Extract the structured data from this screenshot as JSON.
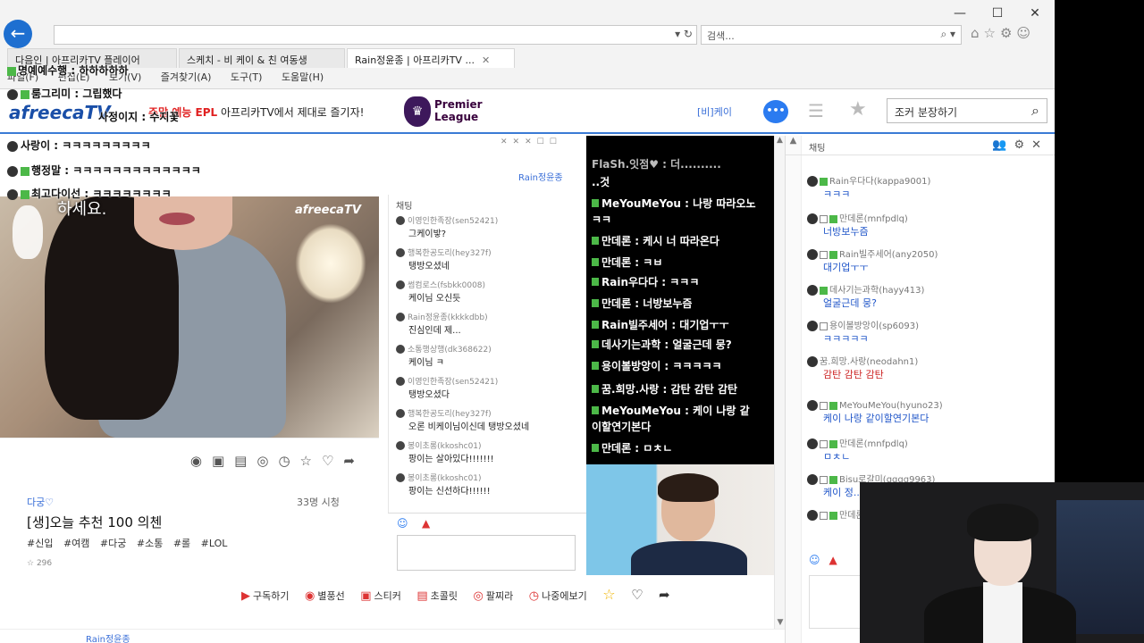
{
  "browser": {
    "search_placeholder": "검색...",
    "tabs": [
      {
        "label": "다음인 | 아프리카TV 플레이어"
      },
      {
        "label": "스케치 - 비 케이 & 친 여동생"
      },
      {
        "label": "Rain정윤종 | 아프리카TV ..."
      }
    ],
    "menu": [
      "파일(F)",
      "편집(E)",
      "보기(V)",
      "즐겨찾기(A)",
      "도구(T)",
      "도움말(H)"
    ]
  },
  "header": {
    "logo": "afreecaTV",
    "promo_red": "주말 예능 EPL",
    "promo_rest": "아프리카TV에서 제대로 즐기자!",
    "pl_line1": "Premier",
    "pl_line2": "League",
    "user": "[비]케이",
    "search_placeholder": "조커 분장하기"
  },
  "overlay_chat": [
    "명예예수행 : 하하하하하",
    "룸그리미 : 그립했다",
    "사정이지 : 수지꽃",
    "사랑이 : ㅋㅋㅋㅋㅋㅋㅋㅋㅋ",
    "행정말 : ㅋㅋㅋㅋㅋㅋㅋㅋㅋㅋㅋㅋㅋ",
    "최고다이선 : ㅋㅋㅋㅋㅋㅋㅋㅋ"
  ],
  "inner": {
    "user": "Rain정윤종",
    "video_logo": "afreecaTV",
    "video_caption": "하세요."
  },
  "stream": {
    "streamer": "다궁♡",
    "viewers": "33명 시청",
    "title": "[생]오늘 추천 100 의첸",
    "tags": "#신입 #여캠 #다궁 #소통 #롤 #LOL",
    "likes": "296"
  },
  "mid_chat": {
    "title": "채팅",
    "messages": [
      {
        "nick": "이영인한족장(sen52421)",
        "text": "그케이밯?"
      },
      {
        "nick": "행복한공도리(hey327f)",
        "text": "탱방오셨네"
      },
      {
        "nick": "썸컴로스(fsbkk0008)",
        "text": "케이님 오신듯"
      },
      {
        "nick": "Rain정윤종(kkkkdbb)",
        "text": "진심인데 제..."
      },
      {
        "nick": "소통행상행(dk368622)",
        "text": "케이님 ㅋ"
      },
      {
        "nick": "이영인한족장(sen52421)",
        "text": "탱방오셨다"
      },
      {
        "nick": "행복한공도리(hey327f)",
        "text": "오론 비케이님이신데 탱방오셨네"
      },
      {
        "nick": "봉이초롱(kkoshc01)",
        "text": "팡이는 살아있다!!!!!!!"
      },
      {
        "nick": "봉이초롱(kkoshc01)",
        "text": "팡이는 신선하다!!!!!!"
      }
    ]
  },
  "action_bar": [
    "구독하기",
    "별풍선",
    "스티커",
    "초콜릿",
    "팔찌라",
    "나중에보기"
  ],
  "black_chat": [
    "FlaSh.잇점♥ : 더..........",
    "..것",
    "MeYouMeYou : 나랑 따라오노",
    "ㅋㅋ",
    "만데론 : 케시 너 따라온다",
    "만데론 : ㅋㅂ",
    "Rain우다다 : ㅋㅋㅋ",
    "만데론 : 너방보누즘",
    "Rain빌주세어 : 대기업ㅜㅜ",
    "데사기는과학 : 얼굴근데 뭉?",
    "용이볼방앙이 : ㅋㅋㅋㅋㅋ",
    "꿈.희망.사랑 : 감탄 감탄 감탄",
    "MeYouMeYou : 케이 나랑 같",
    "이할연기본다",
    "만데론 : ㅁㅊㄴ"
  ],
  "right_chat": {
    "title": "채팅",
    "messages": [
      {
        "nick": "Rain우다다(kappa9001)",
        "text": "ㅋㅋㅋ"
      },
      {
        "nick": "만데론(mnfpdlq)",
        "text": "너방보누즘"
      },
      {
        "nick": "Rain빌주세어(any2050)",
        "text": "대기업ㅜㅜ"
      },
      {
        "nick": "데사기는과학(hayy413)",
        "text": "얼굴근데 뭉?"
      },
      {
        "nick": "용이볼방앙이(sp6093)",
        "text": "ㅋㅋㅋㅋㅋ"
      },
      {
        "nick": "꿈.희망.사랑(neodahn1)",
        "text": "감탄 감탄 감탄"
      },
      {
        "nick": "MeYouMeYou(hyuno23)",
        "text": "케이 나랑 같이할연기본다"
      },
      {
        "nick": "만데론(mnfpdlq)",
        "text": "ㅁㅊㄴ"
      },
      {
        "nick": "Bisu로갈미(gggg9963)",
        "text": "케이 정..."
      },
      {
        "nick": "만데론",
        "text": ""
      }
    ]
  },
  "bottom": {
    "streamer": "Rain정윤종"
  }
}
